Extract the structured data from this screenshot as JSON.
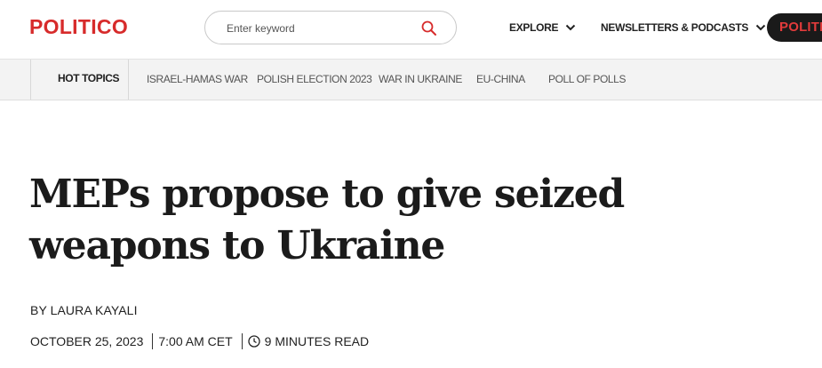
{
  "header": {
    "logo": "POLITICO",
    "search_placeholder": "Enter keyword",
    "nav": [
      {
        "label": "EXPLORE"
      },
      {
        "label": "NEWSLETTERS & PODCASTS"
      }
    ],
    "pro_label": "POLITICO"
  },
  "topics": {
    "hot": "HOT TOPICS",
    "items": [
      {
        "label": "ISRAEL-HAMAS WAR"
      },
      {
        "label": "POLISH ELECTION 2023"
      },
      {
        "label": "WAR IN UKRAINE"
      },
      {
        "label": "EU-CHINA"
      },
      {
        "label": "POLL OF POLLS"
      }
    ]
  },
  "article": {
    "headline": "MEPs propose to give seized weapons to Ukraine",
    "byline": "BY LAURA KAYALI",
    "date": "OCTOBER 25, 2023",
    "time": "7:00 AM CET",
    "read_time": "9 MINUTES READ"
  },
  "colors": {
    "brand_red": "#d72b2b",
    "topics_bg": "#f3f3f3",
    "pro_bg": "#1a1a1a"
  },
  "icons": [
    "search-icon",
    "chevron-down-icon",
    "clock-icon"
  ]
}
